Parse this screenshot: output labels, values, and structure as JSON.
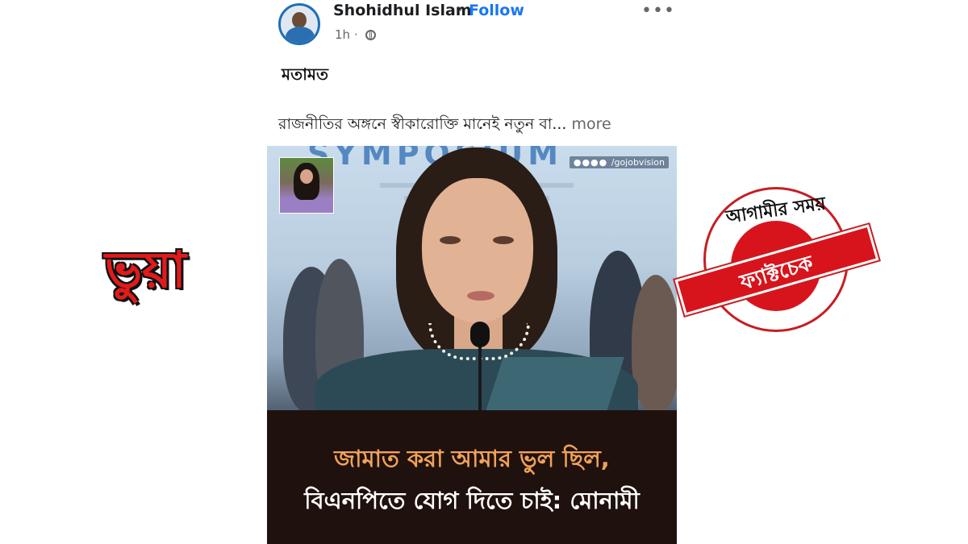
{
  "post": {
    "author": "Shohidhul Islam",
    "separator": "·",
    "follow_label": "Follow",
    "time": "1h ·",
    "category": "মতামত",
    "text": "রাজনীতির অঙ্গনে স্বীকারোক্তি মানেই নতুন বা...",
    "see_more": "more"
  },
  "image": {
    "banner_text": "SYMPOSIUM",
    "watermark_handle": "/gojobvision",
    "caption_line1": "জামাত করা আমার ভুল ছিল,",
    "caption_line2": "বিএনপিতে যোগ দিতে চাই: মোনামী"
  },
  "factcheck": {
    "verdict": "ভুয়া",
    "stamp_brand": "আগামীর সময়",
    "stamp_label": "ফ্যাক্টচেক"
  },
  "colors": {
    "follow": "#1877f2",
    "verdict": "#e01b1b",
    "stamp": "#d7141c",
    "caption_highlight": "#f2a15a"
  },
  "icons": [
    "avatar",
    "globe-icon",
    "more-options-icon"
  ]
}
